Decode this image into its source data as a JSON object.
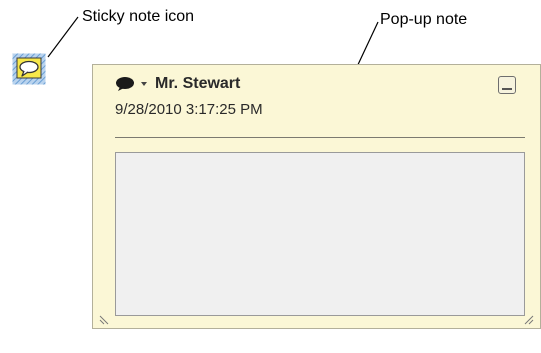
{
  "callouts": {
    "sticky_note_icon": "Sticky note icon",
    "popup_note": "Pop-up note"
  },
  "popup": {
    "author": "Mr. Stewart",
    "timestamp": "9/28/2010 3:17:25 PM",
    "body_text": ""
  },
  "icons": {
    "sticky": "sticky-note-icon",
    "speech": "speech-bubble-icon",
    "dropdown": "chevron-down-icon",
    "minimize": "minimize-icon",
    "resize_left": "resize-grip-icon",
    "resize_right": "resize-grip-icon"
  },
  "colors": {
    "popup_background": "#fbf7d6",
    "body_background": "#f0f0f0",
    "sticky_icon_fill": "#f7e84a",
    "sticky_icon_border": "#6a9fd4"
  }
}
